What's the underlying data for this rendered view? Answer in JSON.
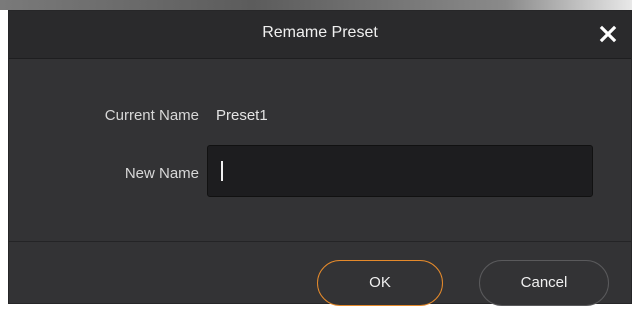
{
  "dialog": {
    "title": "Remame Preset",
    "close_icon": "close-icon"
  },
  "form": {
    "current_name_label": "Current Name",
    "current_name_value": "Preset1",
    "new_name_label": "New Name",
    "new_name_value": "",
    "new_name_placeholder": ""
  },
  "buttons": {
    "ok_label": "OK",
    "cancel_label": "Cancel"
  },
  "colors": {
    "accent": "#e58a2b",
    "dialog_bg": "#333335",
    "titlebar_bg": "#2a2a2c",
    "input_bg": "#1d1d1f"
  }
}
